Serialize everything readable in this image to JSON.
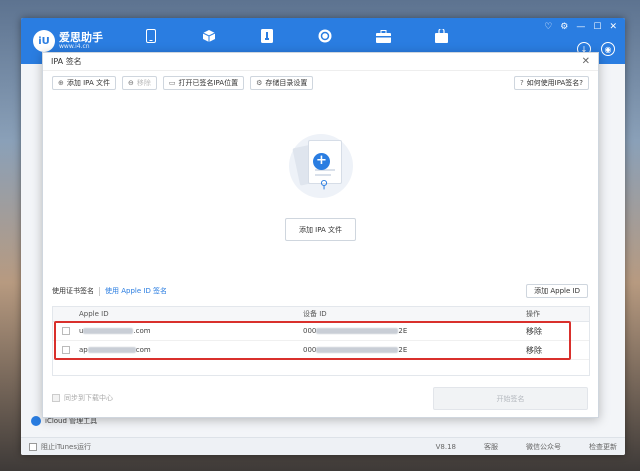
{
  "app": {
    "logo_mark": "iU",
    "name": "爱思助手",
    "url": "www.i4.cn",
    "nav_icons": [
      "phone-icon",
      "cube-icon",
      "apps-icon",
      "refresh-icon",
      "toolbox-icon",
      "briefcase-icon"
    ],
    "accent_color": "#2a7de1"
  },
  "dialog": {
    "title": "IPA 签名",
    "close": "✕",
    "toolbar": {
      "add_ipa": "添加 IPA 文件",
      "delete": "移除",
      "open_signed_location": "打开已签名IPA位置",
      "storage_dir": "存储目录设置",
      "help": "如何使用IPA签名?"
    },
    "drop_area": {
      "add_button": "添加 IPA 文件"
    },
    "tabs": {
      "cert_sign": "使用证书签名",
      "appleid_sign": "使用 Apple ID 签名"
    },
    "add_appleid_button": "添加 Apple ID",
    "table": {
      "headers": {
        "apple_id": "Apple ID",
        "device_id": "设备 ID",
        "action": "操作"
      },
      "rows": [
        {
          "apple_id_prefix": "u",
          "apple_id_suffix": ".com",
          "device_prefix": "000",
          "device_suffix": "2E",
          "action": "移除"
        },
        {
          "apple_id_prefix": "ap",
          "apple_id_suffix": "com",
          "device_prefix": "000",
          "device_suffix": "2E",
          "action": "移除"
        }
      ]
    },
    "sync_label": "同步到下载中心",
    "start_button": "开始签名"
  },
  "background": {
    "icloud_label": "iCloud 管理工具"
  },
  "statusbar": {
    "block_itunes": "阻止iTunes运行",
    "version": "V8.18",
    "customer_service": "客服",
    "wechat": "微信公众号",
    "check_update": "检查更新"
  }
}
